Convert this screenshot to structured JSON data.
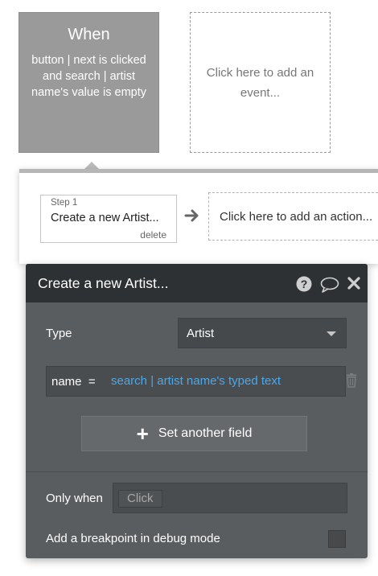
{
  "event": {
    "when_label": "When",
    "description": "button | next is clicked and search | artist name's value is empty",
    "add_event_label": "Click here to add an event..."
  },
  "workflow": {
    "step_number": "Step 1",
    "step_title": "Create a new Artist...",
    "delete_label": "delete",
    "add_action_label": "Click here to add an action..."
  },
  "editor": {
    "title": "Create a new Artist...",
    "type_label": "Type",
    "type_value": "Artist",
    "field_name": "name  =",
    "field_value": "search | artist name's typed text",
    "set_field_label": "Set another field",
    "only_when_label": "Only when",
    "only_when_placeholder": "Click",
    "breakpoint_label": "Add a breakpoint in debug mode"
  },
  "icons": {
    "help": "help-icon",
    "comment": "comment-icon",
    "close": "close-icon",
    "trash": "trash-icon",
    "arrow": "arrow-right-icon",
    "plus": "plus-icon"
  },
  "colors": {
    "event_card_bg": "#9a9a9a",
    "editor_bg": "#5a5d60",
    "editor_header_bg": "#2e3133",
    "dynamic_text": "#4aa8e8"
  }
}
